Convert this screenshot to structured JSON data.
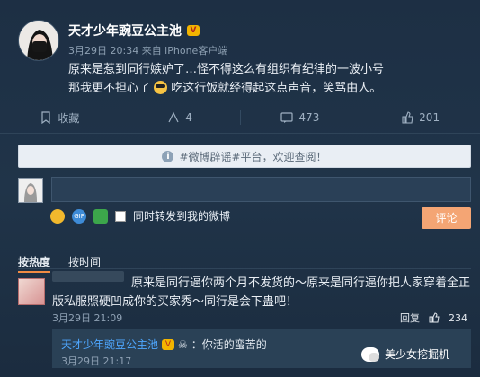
{
  "post": {
    "author": "天才少年豌豆公主池",
    "badge": "V",
    "meta": "3月29日 20:34 来自 iPhone客户端",
    "line1": "原来是惹到同行嫉妒了…怪不得这么有组织有纪律的一波小号",
    "line2_before": "那我更不担心了",
    "line2_after": "吃这行饭就经得起这点声音，笑骂由人。",
    "emoji": "cool-face-emoji"
  },
  "actions": [
    {
      "label": "收藏",
      "icon": "bookmark-icon"
    },
    {
      "label": "4",
      "icon": "share-icon"
    },
    {
      "label": "473",
      "icon": "comment-icon"
    },
    {
      "label": "201",
      "icon": "like-icon"
    }
  ],
  "banner": {
    "text": "#微博辟谣#平台，欢迎查阅！"
  },
  "comment_input": {
    "placeholder": ""
  },
  "tools": {
    "forward_label": "同时转发到我的微博",
    "submit_label": "评论"
  },
  "sort": {
    "hot": "按热度",
    "time": "按时间"
  },
  "comment": {
    "text": "原来是同行逼你两个月不发货的～原来是同行逼你把人家穿着全正版私服照硬凹成你的买家秀～同行是会下蛊吧！",
    "meta": "3月29日 21:09",
    "reply_label": "回复",
    "likes": "234"
  },
  "reply": {
    "author": "天才少年豌豆公主池",
    "text": "：你活的蛮苦的",
    "meta": "3月29日 21:17"
  },
  "watermark": {
    "text": "美少女挖掘机"
  },
  "colors": {
    "accent": "#f4a574",
    "link": "#4ea7ff"
  }
}
